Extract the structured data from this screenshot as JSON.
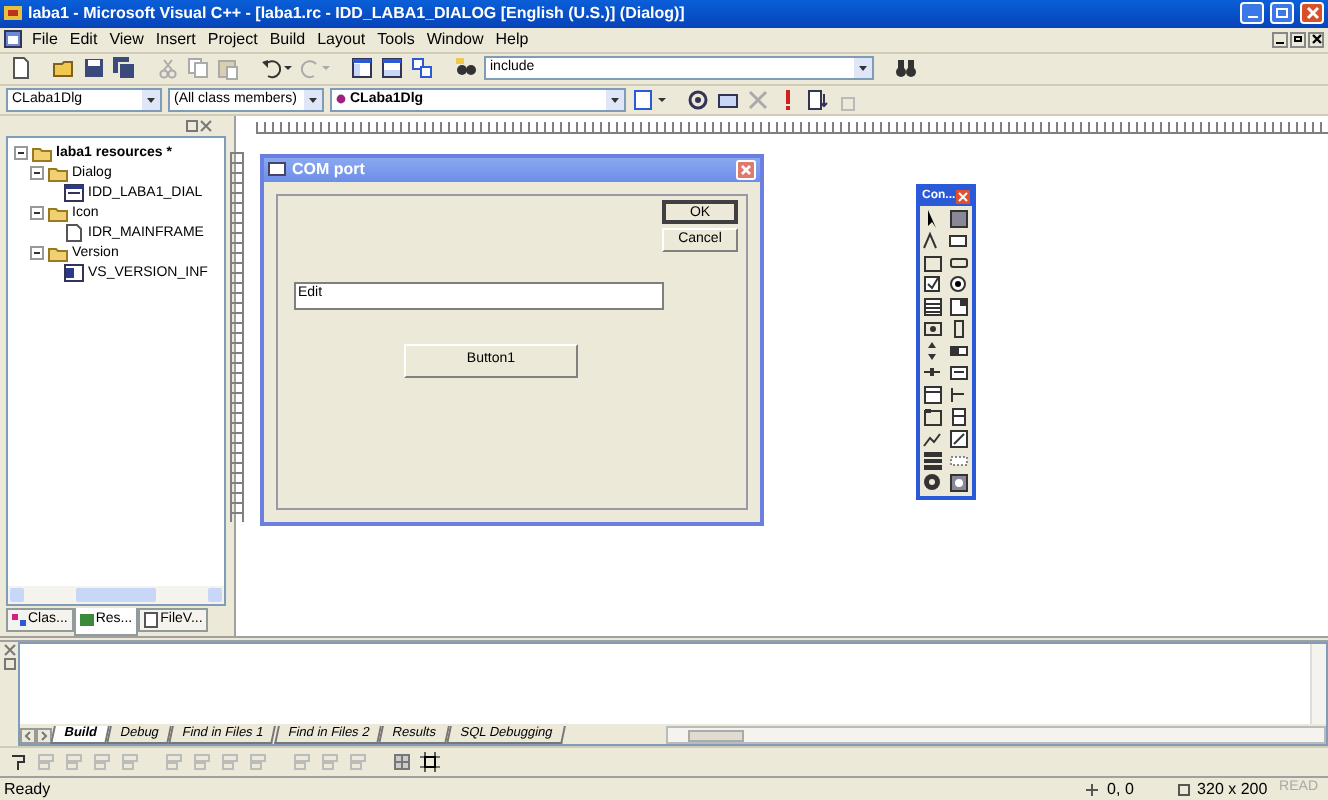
{
  "window": {
    "title": "laba1 - Microsoft Visual C++ - [laba1.rc - IDD_LABA1_DIALOG [English (U.S.)] (Dialog)]"
  },
  "menu": [
    "File",
    "Edit",
    "View",
    "Insert",
    "Project",
    "Build",
    "Layout",
    "Tools",
    "Window",
    "Help"
  ],
  "toolbar": {
    "find_combo": "include"
  },
  "wizard_bar": {
    "class_combo": "CLaba1Dlg",
    "members_combo": "(All class members)",
    "function_combo": "CLaba1Dlg"
  },
  "workspace": {
    "tree": [
      {
        "label": "laba1 resources *",
        "expanded": true,
        "children": [
          {
            "label": "Dialog",
            "expanded": true,
            "children": [
              {
                "label": "IDD_LABA1_DIAL",
                "kind": "dialog"
              }
            ]
          },
          {
            "label": "Icon",
            "expanded": true,
            "children": [
              {
                "label": "IDR_MAINFRAME",
                "kind": "icon"
              }
            ]
          },
          {
            "label": "Version",
            "expanded": true,
            "children": [
              {
                "label": "VS_VERSION_INF",
                "kind": "version"
              }
            ]
          }
        ]
      }
    ],
    "tabs": [
      {
        "label": "Clas...",
        "selected": false
      },
      {
        "label": "Res...",
        "selected": true
      },
      {
        "label": "FileV...",
        "selected": false
      }
    ]
  },
  "dialog": {
    "title": "COM port",
    "buttons": [
      {
        "label": "OK",
        "default": true
      },
      {
        "label": "Cancel",
        "default": false
      }
    ],
    "edit": {
      "value": "Edit"
    },
    "button": {
      "label": "Button1"
    }
  },
  "controls_palette": {
    "title": "Con..."
  },
  "output": {
    "tabs": [
      {
        "label": "Build",
        "selected": true
      },
      {
        "label": "Debug",
        "selected": false
      },
      {
        "label": "Find in Files 1",
        "selected": false
      },
      {
        "label": "Find in Files 2",
        "selected": false
      },
      {
        "label": "Results",
        "selected": false
      },
      {
        "label": "SQL Debugging",
        "selected": false
      }
    ]
  },
  "status_bar": {
    "message": "Ready",
    "position": "0, 0",
    "size": "320 x 200",
    "mode": {
      "label": "READ",
      "active": false
    }
  }
}
